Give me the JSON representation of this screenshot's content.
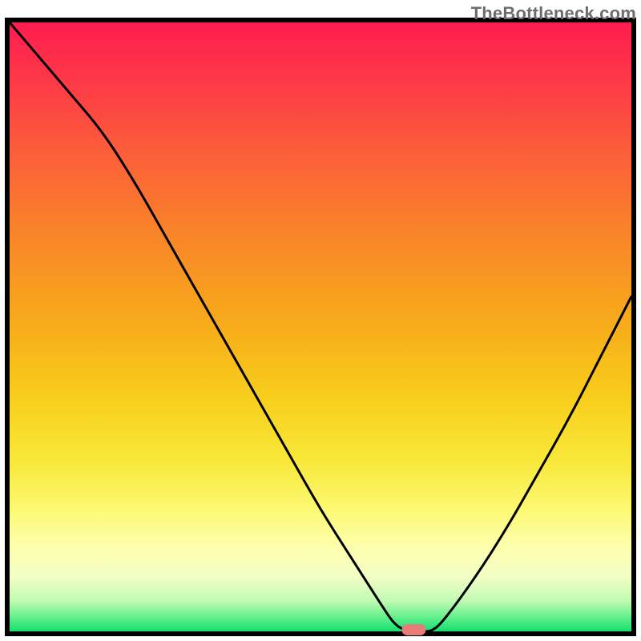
{
  "watermark": "TheBottleneck.com",
  "chart_data": {
    "type": "line",
    "title": "",
    "xlabel": "",
    "ylabel": "",
    "xlim": [
      0,
      100
    ],
    "ylim": [
      0,
      100
    ],
    "x": [
      0,
      5,
      10,
      15,
      20,
      25,
      30,
      35,
      40,
      45,
      50,
      55,
      60,
      62,
      64,
      66,
      68,
      70,
      75,
      80,
      85,
      90,
      95,
      100
    ],
    "values": [
      100,
      94,
      88,
      82,
      74,
      65,
      56,
      47,
      38,
      29,
      20,
      12,
      4,
      1,
      0,
      0,
      0,
      2,
      9,
      17,
      26,
      35,
      45,
      55
    ],
    "marker": {
      "x": 65,
      "y": 0,
      "color": "#e97a7a"
    },
    "background_gradient_stops": [
      {
        "offset": 0.0,
        "color": "#fe1c50"
      },
      {
        "offset": 0.1,
        "color": "#fe3a47"
      },
      {
        "offset": 0.22,
        "color": "#fc6039"
      },
      {
        "offset": 0.35,
        "color": "#f98528"
      },
      {
        "offset": 0.5,
        "color": "#f7ad1a"
      },
      {
        "offset": 0.62,
        "color": "#f8cf1c"
      },
      {
        "offset": 0.72,
        "color": "#f9e83a"
      },
      {
        "offset": 0.8,
        "color": "#fcf972"
      },
      {
        "offset": 0.86,
        "color": "#feffad"
      },
      {
        "offset": 0.91,
        "color": "#f3fec5"
      },
      {
        "offset": 0.95,
        "color": "#c0fab2"
      },
      {
        "offset": 0.975,
        "color": "#6af08e"
      },
      {
        "offset": 1.0,
        "color": "#14e071"
      }
    ],
    "axis_color": "#000000",
    "line_color": "#000000"
  }
}
